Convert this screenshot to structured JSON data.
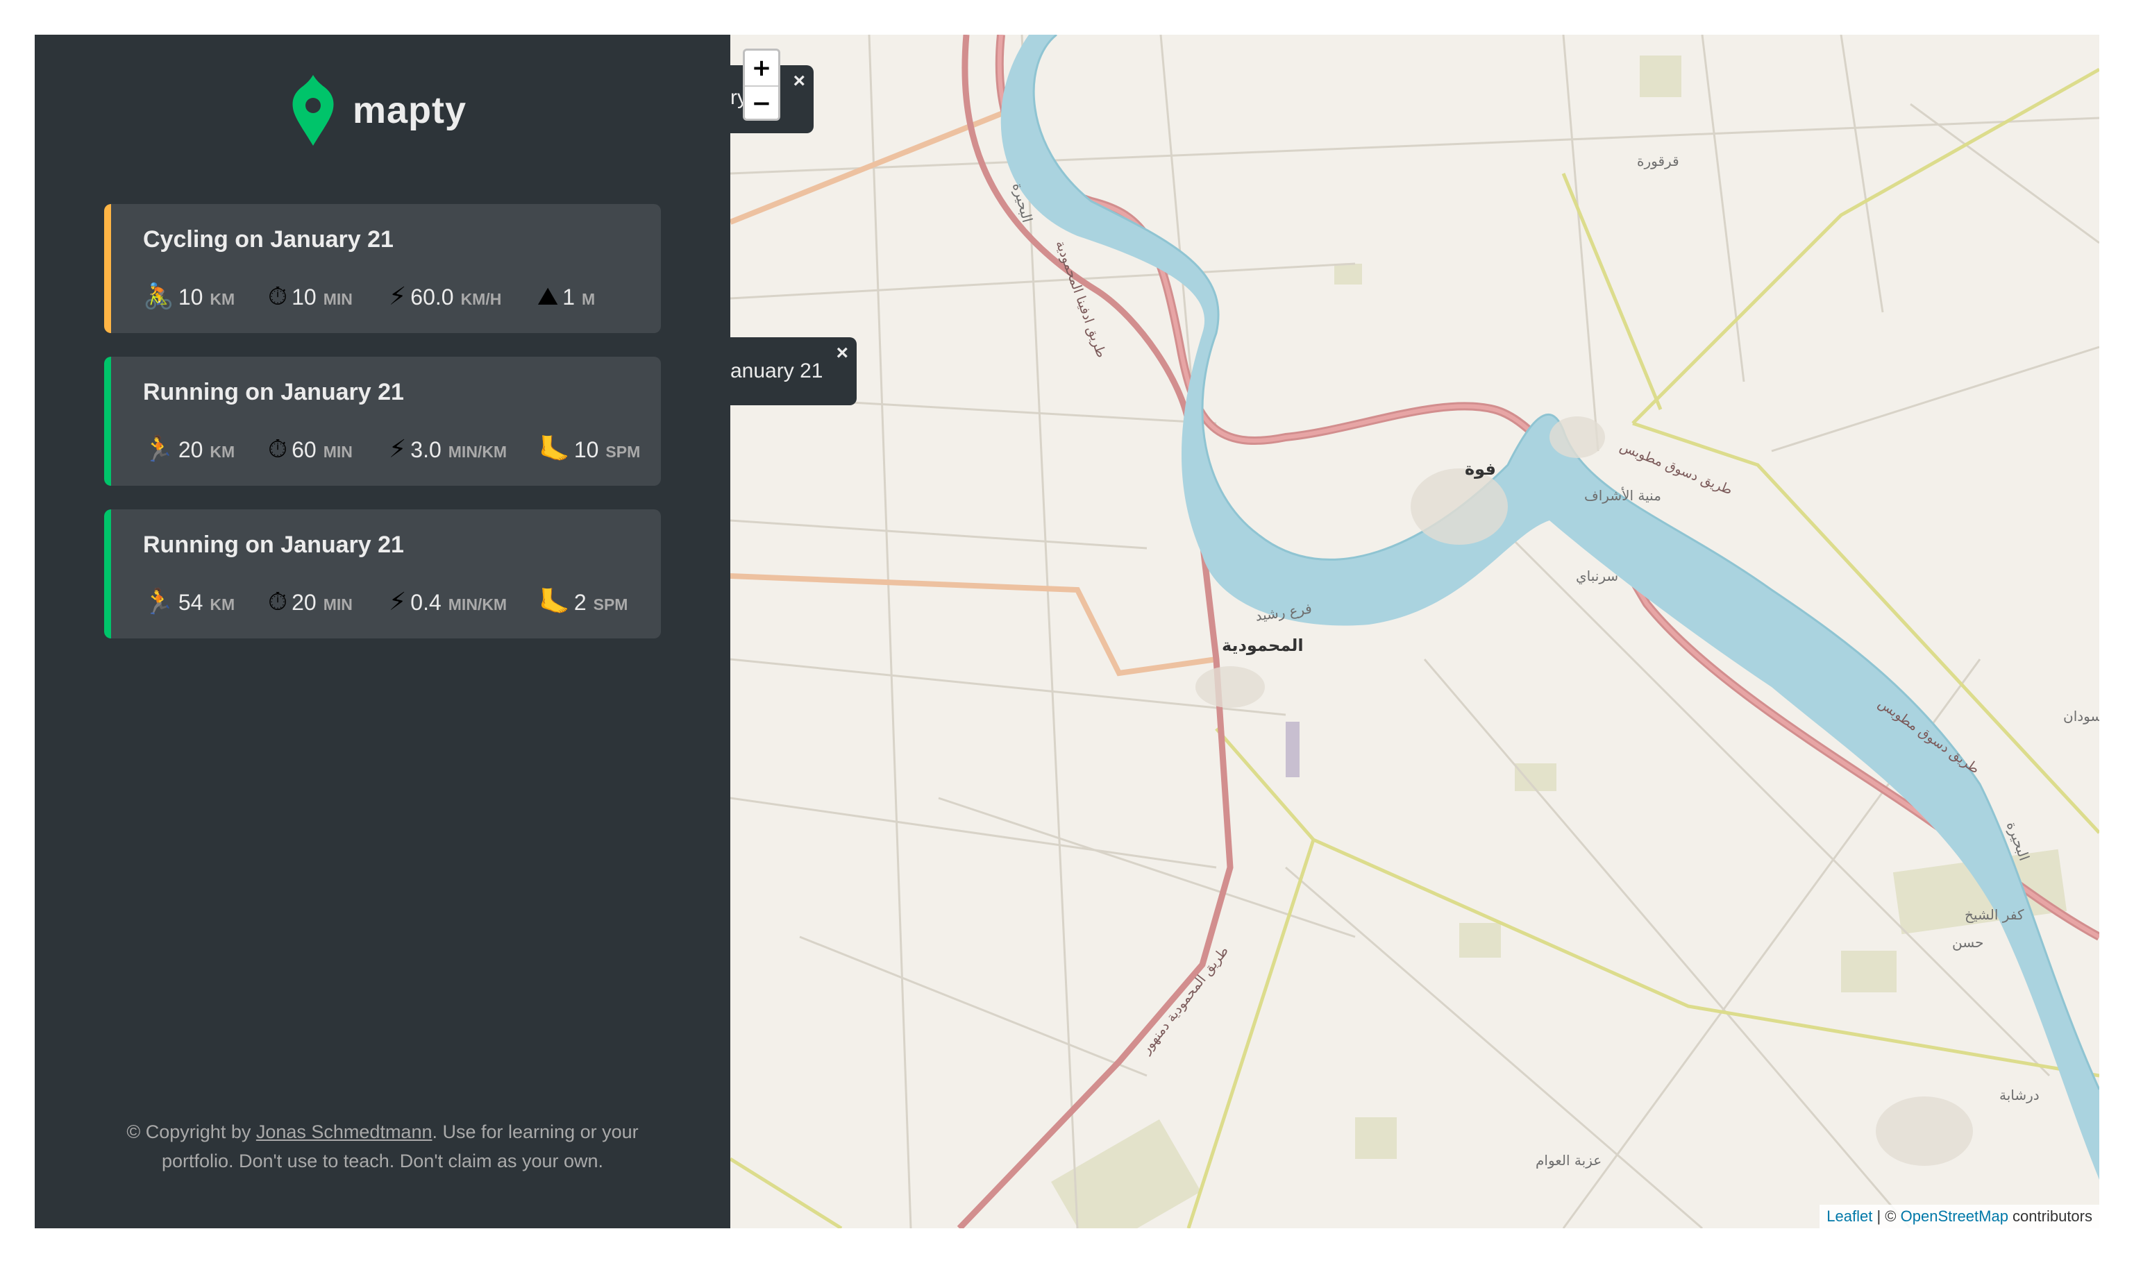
{
  "brand": {
    "name": "mapty",
    "logo_color": "#00c46a"
  },
  "workouts": [
    {
      "type": "cycling",
      "title": "Cycling on January 21",
      "accent": "#ffb545",
      "details": [
        {
          "icon": "bicycle-icon",
          "value": "10",
          "unit": "km"
        },
        {
          "icon": "stopwatch-icon",
          "value": "10",
          "unit": "min"
        },
        {
          "icon": "lightning-icon",
          "value": "60.0",
          "unit": "km/h"
        },
        {
          "icon": "mountain-icon",
          "value": "1",
          "unit": "m"
        }
      ]
    },
    {
      "type": "running",
      "title": "Running on January 21",
      "accent": "#00c46a",
      "details": [
        {
          "icon": "runner-icon",
          "value": "20",
          "unit": "km"
        },
        {
          "icon": "stopwatch-icon",
          "value": "60",
          "unit": "min"
        },
        {
          "icon": "lightning-icon",
          "value": "3.0",
          "unit": "min/km"
        },
        {
          "icon": "footprint-icon",
          "value": "10",
          "unit": "spm"
        }
      ]
    },
    {
      "type": "running",
      "title": "Running on January 21",
      "accent": "#00c46a",
      "details": [
        {
          "icon": "runner-icon",
          "value": "54",
          "unit": "km"
        },
        {
          "icon": "stopwatch-icon",
          "value": "20",
          "unit": "min"
        },
        {
          "icon": "lightning-icon",
          "value": "0.4",
          "unit": "min/km"
        },
        {
          "icon": "footprint-icon",
          "value": "2",
          "unit": "spm"
        }
      ]
    }
  ],
  "copyright": {
    "prefix": "© Copyright by ",
    "author": "Jonas Schmedtmann",
    "suffix": ". Use for learning or your portfolio. Don't use to teach. Don't claim as your own."
  },
  "map": {
    "zoom_in": "+",
    "zoom_out": "−",
    "popups": [
      {
        "text": "ry",
        "close": "×"
      },
      {
        "text": "anuary 21",
        "close": "×"
      }
    ],
    "labels": {
      "town_fouh": "فوة",
      "town_mahmoudia": "المحمودية",
      "qarqura": "قرقورة",
      "sirnbay": "سرنباي",
      "minyat_ashraf": "منية الأشراف",
      "kafr_sheikh_1": "كفر الشيخ",
      "kafr_sheikh_2": "كفر الشيخ",
      "hasan": "حسن",
      "darshaba": "درشابة",
      "izbat_awam": "عزبة العوام",
      "sudan": "سودان",
      "branch_rashid": "فرع رشيد",
      "road_desouk_1": "طريق دسوق مطوبس",
      "road_desouk_2": "طريق دسوق مطوبس",
      "road_edfina": "طريق ادفينا المحمودية",
      "road_mahmoudia_damanhour": "طريق المحمودية دمنهور",
      "beheira_1": "البحيرة",
      "beheira_2": "البحيرة"
    },
    "attribution": {
      "leaflet": "Leaflet",
      "separator": " | © ",
      "osm": "OpenStreetMap",
      "suffix": " contributors"
    }
  }
}
